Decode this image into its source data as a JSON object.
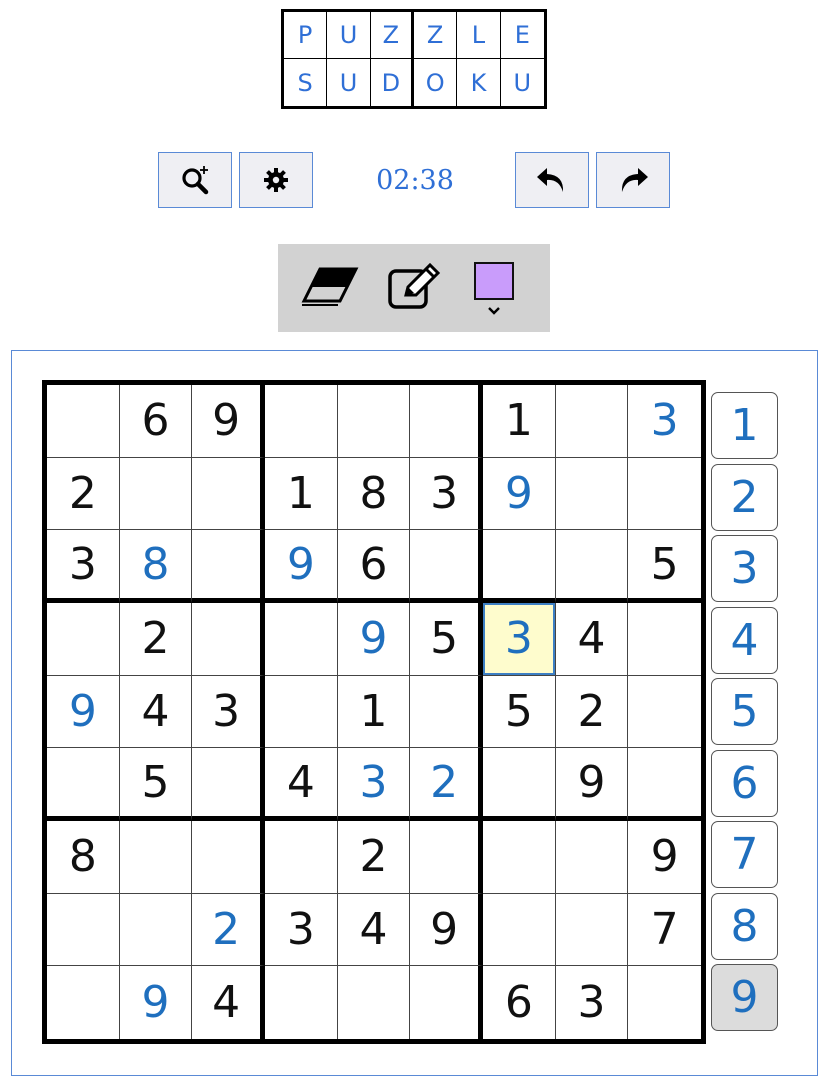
{
  "logo": {
    "row1": [
      "P",
      "U",
      "Z",
      "Z",
      "L",
      "E"
    ],
    "row2": [
      "S",
      "U",
      "D",
      "O",
      "K",
      "U"
    ]
  },
  "toolbar": {
    "zoom_icon": "zoom-in-icon",
    "settings_icon": "gear-icon",
    "timer": "02:38",
    "undo_icon": "undo-arrow-icon",
    "redo_icon": "redo-arrow-icon"
  },
  "tools": {
    "eraser_icon": "eraser-icon",
    "pencil_icon": "pencil-notes-icon",
    "color_value": "#c99cfb"
  },
  "board": {
    "cells": [
      [
        "",
        "6",
        "9",
        "",
        "",
        "",
        "1",
        "",
        "3"
      ],
      [
        "2",
        "",
        "",
        "1",
        "8",
        "3",
        "9",
        "",
        ""
      ],
      [
        "3",
        "8",
        "",
        "9",
        "6",
        "",
        "",
        "",
        "5"
      ],
      [
        "",
        "2",
        "",
        "",
        "9",
        "5",
        "3",
        "4",
        ""
      ],
      [
        "9",
        "4",
        "3",
        "",
        "1",
        "",
        "5",
        "2",
        ""
      ],
      [
        "",
        "5",
        "",
        "4",
        "3",
        "2",
        "",
        "9",
        ""
      ],
      [
        "8",
        "",
        "",
        "",
        "2",
        "",
        "",
        "",
        "9"
      ],
      [
        "",
        "",
        "2",
        "3",
        "4",
        "9",
        "",
        "",
        "7"
      ],
      [
        "",
        "9",
        "4",
        "",
        "",
        "",
        "6",
        "3",
        ""
      ]
    ],
    "user_entries": [
      [
        0,
        8
      ],
      [
        1,
        6
      ],
      [
        2,
        1
      ],
      [
        2,
        3
      ],
      [
        3,
        4
      ],
      [
        3,
        6
      ],
      [
        4,
        0
      ],
      [
        5,
        4
      ],
      [
        5,
        5
      ],
      [
        7,
        2
      ],
      [
        8,
        1
      ]
    ],
    "selected": [
      3,
      6
    ],
    "given_color": "#111111",
    "user_color": "#1f6fbe",
    "selected_bg": "#fefccd"
  },
  "numpad": {
    "keys": [
      "1",
      "2",
      "3",
      "4",
      "5",
      "6",
      "7",
      "8",
      "9"
    ],
    "active": "9"
  }
}
